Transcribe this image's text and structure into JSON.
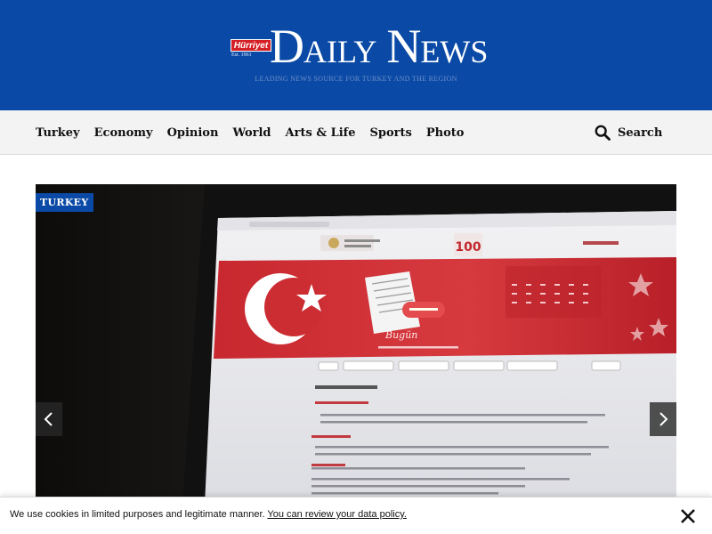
{
  "masthead": {
    "badge_brand": "Hürriyet",
    "badge_est": "Est. 1961",
    "logo_cap_d": "D",
    "logo_aily": "AILY",
    "logo_cap_n": "N",
    "logo_ews": "EWS",
    "tagline": "LEADING NEWS SOURCE FOR TURKEY AND THE REGION",
    "background_color": "#0a4aa6"
  },
  "nav": {
    "items": [
      {
        "label": "Turkey"
      },
      {
        "label": "Economy"
      },
      {
        "label": "Opinion"
      },
      {
        "label": "World"
      },
      {
        "label": "Arts & Life"
      },
      {
        "label": "Sports"
      },
      {
        "label": "Photo"
      }
    ],
    "search_label": "Search",
    "search_icon": "search-icon"
  },
  "hero": {
    "category_badge": "TURKEY",
    "badge_color": "#0a4aa6",
    "prev_icon": "chevron-left-icon",
    "next_icon": "chevron-right-icon",
    "screen_content": {
      "heading": "Bugün",
      "center_badge": "100"
    }
  },
  "cookie": {
    "text": "We use cookies in limited purposes and legitimate manner.",
    "link": "You can review your data policy.",
    "close_icon": "close-icon"
  }
}
